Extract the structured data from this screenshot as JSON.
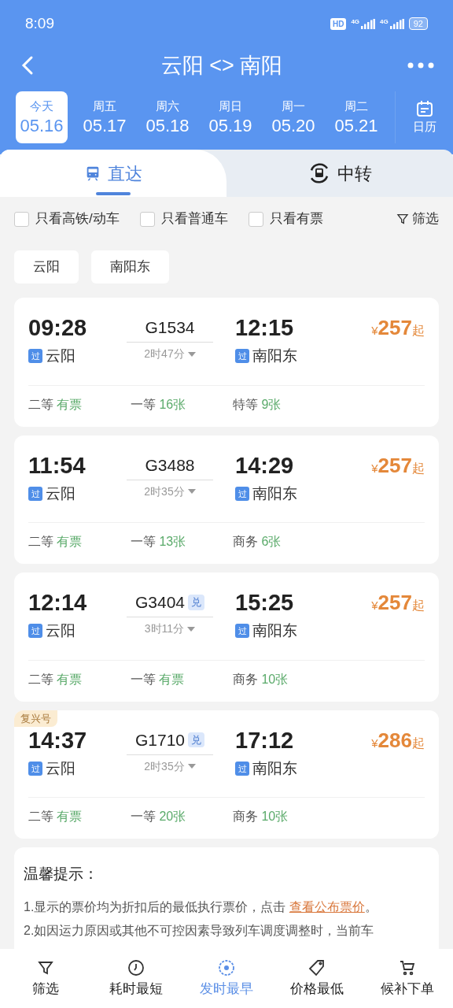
{
  "status_bar": {
    "time": "8:09",
    "hd": "HD",
    "network_1": "4G",
    "network_2": "4G",
    "battery": "92"
  },
  "header": {
    "title": "云阳 <> 南阳"
  },
  "dates": [
    {
      "weekday": "今天",
      "date": "05.16",
      "selected": true
    },
    {
      "weekday": "周五",
      "date": "05.17",
      "selected": false
    },
    {
      "weekday": "周六",
      "date": "05.18",
      "selected": false
    },
    {
      "weekday": "周日",
      "date": "05.19",
      "selected": false
    },
    {
      "weekday": "周一",
      "date": "05.20",
      "selected": false
    },
    {
      "weekday": "周二",
      "date": "05.21",
      "selected": false
    }
  ],
  "calendar_label": "日历",
  "tabs": [
    {
      "label": "直达",
      "kind": "direct",
      "selected": true
    },
    {
      "label": "中转",
      "kind": "transfer",
      "selected": false
    }
  ],
  "filters": [
    {
      "label": "只看高铁/动车",
      "checked": false
    },
    {
      "label": "只看普通车",
      "checked": false
    },
    {
      "label": "只看有票",
      "checked": false
    }
  ],
  "filter_button": "筛选",
  "stations": [
    "云阳",
    "南阳东"
  ],
  "trains": [
    {
      "dep_time": "09:28",
      "train_no": "G1534",
      "arr_time": "12:15",
      "dep_tag": "过",
      "dep_station": "云阳",
      "arr_tag": "过",
      "arr_station": "南阳东",
      "duration": "2时47分",
      "currency": "¥",
      "price": "257",
      "price_suffix": "起",
      "seats": [
        {
          "class": "二等",
          "availability": "有票"
        },
        {
          "class": "一等",
          "availability": "16张"
        },
        {
          "class": "特等",
          "availability": "9张"
        }
      ]
    },
    {
      "dep_time": "11:54",
      "train_no": "G3488",
      "arr_time": "14:29",
      "dep_tag": "过",
      "dep_station": "云阳",
      "arr_tag": "过",
      "arr_station": "南阳东",
      "duration": "2时35分",
      "currency": "¥",
      "price": "257",
      "price_suffix": "起",
      "seats": [
        {
          "class": "二等",
          "availability": "有票"
        },
        {
          "class": "一等",
          "availability": "13张"
        },
        {
          "class": "商务",
          "availability": "6张"
        }
      ]
    },
    {
      "dep_time": "12:14",
      "train_no": "G3404",
      "exchange_tag": "兑",
      "arr_time": "15:25",
      "dep_tag": "过",
      "dep_station": "云阳",
      "arr_tag": "过",
      "arr_station": "南阳东",
      "duration": "3时11分",
      "currency": "¥",
      "price": "257",
      "price_suffix": "起",
      "seats": [
        {
          "class": "二等",
          "availability": "有票"
        },
        {
          "class": "一等",
          "availability": "有票"
        },
        {
          "class": "商务",
          "availability": "10张"
        }
      ]
    },
    {
      "badge": "复兴号",
      "dep_time": "14:37",
      "train_no": "G1710",
      "exchange_tag": "兑",
      "arr_time": "17:12",
      "dep_tag": "过",
      "dep_station": "云阳",
      "arr_tag": "过",
      "arr_station": "南阳东",
      "duration": "2时35分",
      "currency": "¥",
      "price": "286",
      "price_suffix": "起",
      "seats": [
        {
          "class": "二等",
          "availability": "有票"
        },
        {
          "class": "一等",
          "availability": "20张"
        },
        {
          "class": "商务",
          "availability": "10张"
        }
      ]
    }
  ],
  "notice": {
    "title": "温馨提示：",
    "lines": [
      {
        "text": "1.显示的票价均为折扣后的最低执行票价，点击 ",
        "link": "查看公布票价",
        "end": "。"
      },
      {
        "text": "2.如因运力原因或其他不可控因素导致列车调度调整时，当前车"
      }
    ]
  },
  "bottom_nav": [
    {
      "label": "筛选",
      "kind": "filter",
      "selected": false
    },
    {
      "label": "耗时最短",
      "kind": "timer",
      "selected": false
    },
    {
      "label": "发时最早",
      "kind": "clock24",
      "selected": true
    },
    {
      "label": "价格最低",
      "kind": "tag",
      "selected": false
    },
    {
      "label": "候补下单",
      "kind": "cart",
      "selected": false
    }
  ]
}
